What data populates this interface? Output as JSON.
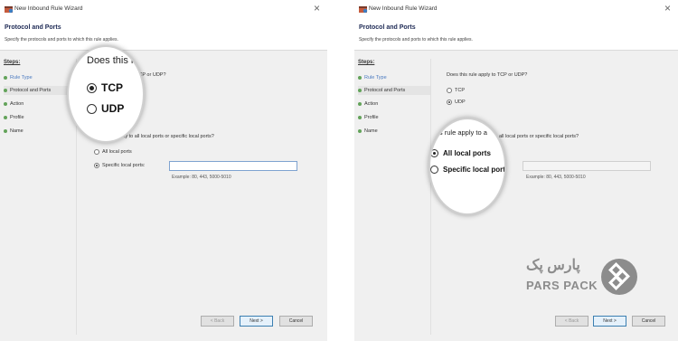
{
  "wizard": {
    "window_title": "New Inbound Rule Wizard",
    "close_glyph": "×",
    "header_title": "Protocol and Ports",
    "header_subtitle": "Specify the protocols and ports to which this rule applies.",
    "steps_label": "Steps:",
    "steps": [
      "Rule Type",
      "Protocol and Ports",
      "Action",
      "Profile",
      "Name"
    ],
    "protocol_question": "Does this rule apply to TCP or UDP?",
    "protocol_question_partial": "TCP or UDP?",
    "protocol_options": [
      "TCP",
      "UDP"
    ],
    "ports_question": "Does this rule apply to all local ports or specific local ports?",
    "ports_question_partial": "pply to all local ports or specific local ports?",
    "ports_question_partial_right": "all local ports or specific local ports?",
    "ports_options": [
      "All local ports",
      "Specific local ports:"
    ],
    "ports_input_value": "",
    "example": "Example: 80, 443, 5000-5010",
    "buttons": {
      "back": "< Back",
      "next": "Next >",
      "cancel": "Cancel"
    }
  },
  "left_magnifier": {
    "question": "Does this ru",
    "options": [
      "TCP",
      "UDP"
    ],
    "selected": "TCP"
  },
  "right_magnifier": {
    "question": "this rule apply to a",
    "options": [
      "All local ports",
      "Specific local ports"
    ],
    "selected": "All local ports"
  },
  "brand": {
    "name_fa": "پارس پک",
    "name_en": "PARS PACK",
    "logo_icon": "diamond-logo-icon",
    "color": "#8c8c8c"
  }
}
